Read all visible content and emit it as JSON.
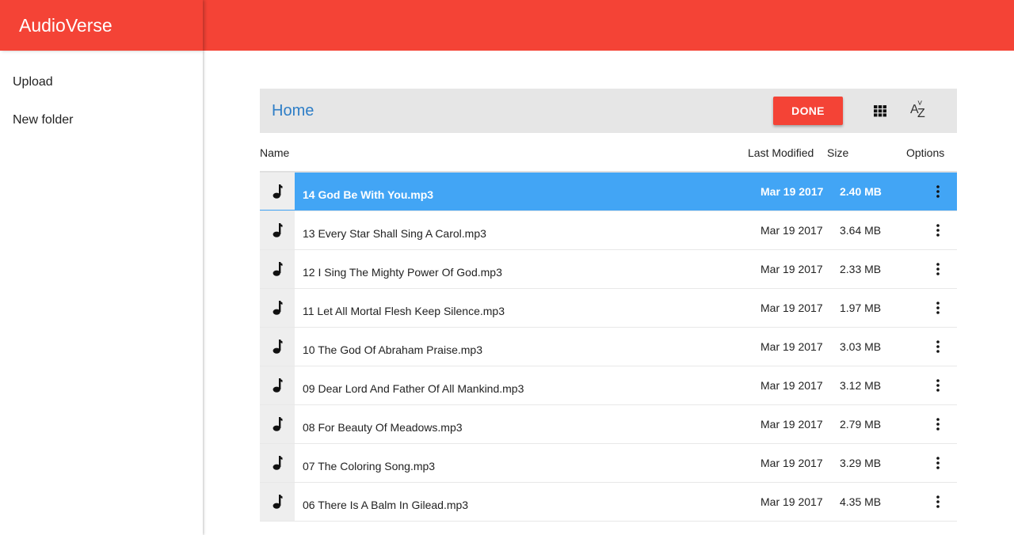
{
  "app": {
    "title": "AudioVerse",
    "brand_color": "#f44336"
  },
  "sidebar": {
    "items": [
      {
        "label": "Upload"
      },
      {
        "label": "New folder"
      }
    ]
  },
  "toolbar": {
    "breadcrumb": "Home",
    "done_label": "DONE",
    "grid_icon": "grid-view-icon",
    "sort_icon": "sort-az-icon",
    "sort_glyph_a": "A",
    "sort_glyph_z": "Z"
  },
  "table": {
    "columns": {
      "name": "Name",
      "modified": "Last Modified",
      "size": "Size",
      "options": "Options"
    },
    "selected_color": "#42a5f5",
    "rows": [
      {
        "name": "14 God Be With You.mp3",
        "modified": "Mar 19 2017",
        "size": "2.40 MB",
        "selected": true
      },
      {
        "name": "13 Every Star Shall Sing A Carol.mp3",
        "modified": "Mar 19 2017",
        "size": "3.64 MB"
      },
      {
        "name": "12 I Sing The Mighty Power Of God.mp3",
        "modified": "Mar 19 2017",
        "size": "2.33 MB"
      },
      {
        "name": "11 Let All Mortal Flesh Keep Silence.mp3",
        "modified": "Mar 19 2017",
        "size": "1.97 MB"
      },
      {
        "name": "10 The God Of Abraham Praise.mp3",
        "modified": "Mar 19 2017",
        "size": "3.03 MB"
      },
      {
        "name": "09 Dear Lord And Father Of All Mankind.mp3",
        "modified": "Mar 19 2017",
        "size": "3.12 MB"
      },
      {
        "name": "08 For Beauty Of Meadows.mp3",
        "modified": "Mar 19 2017",
        "size": "2.79 MB"
      },
      {
        "name": "07 The Coloring Song.mp3",
        "modified": "Mar 19 2017",
        "size": "3.29 MB"
      },
      {
        "name": "06 There Is A Balm In Gilead.mp3",
        "modified": "Mar 19 2017",
        "size": "4.35 MB"
      }
    ]
  }
}
